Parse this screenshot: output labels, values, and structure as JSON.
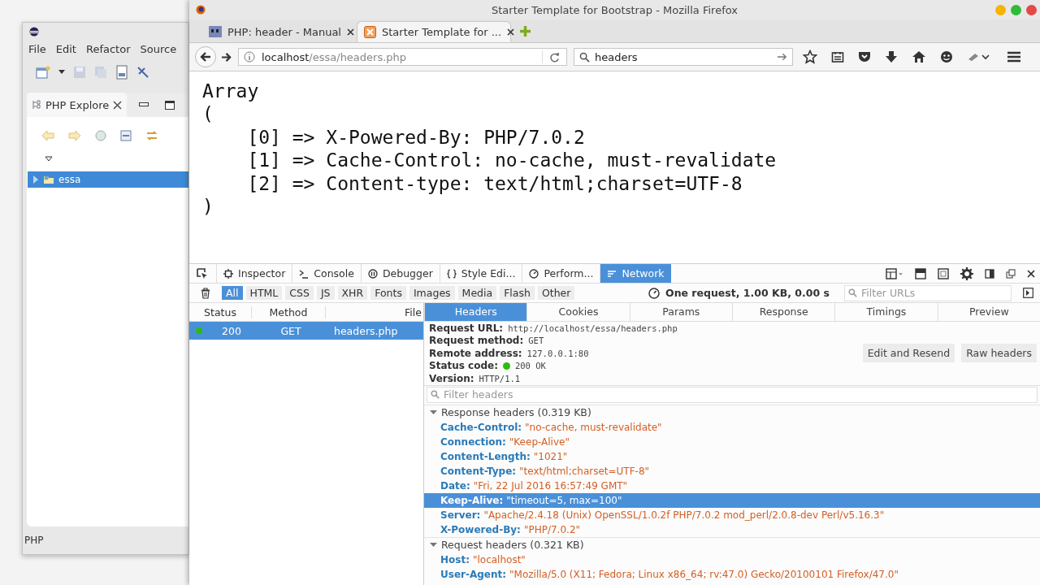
{
  "ide": {
    "menu": [
      "File",
      "Edit",
      "Refactor",
      "Source"
    ],
    "view_tab": "PHP Explore",
    "tree": [
      {
        "label": "essa",
        "expanded": false,
        "selected": true
      }
    ],
    "status": "PHP"
  },
  "browser": {
    "title": "Starter Template for Bootstrap - Mozilla Firefox",
    "tabs": [
      {
        "label": "PHP: header - Manual",
        "kind": "php",
        "selected": false
      },
      {
        "label": "Starter Template for ...",
        "kind": "template",
        "selected": true
      }
    ],
    "url": {
      "host": "localhost",
      "path": "/essa/headers.php"
    },
    "search": "headers"
  },
  "page": {
    "lines": [
      "Array",
      "(",
      "    [0] => X-Powered-By: PHP/7.0.2",
      "    [1] => Cache-Control: no-cache, must-revalidate",
      "    [2] => Content-type: text/html;charset=UTF-8",
      ")"
    ]
  },
  "devtools": {
    "tools": [
      {
        "label": "Inspector",
        "kind": "inspector",
        "selected": false
      },
      {
        "label": "Console",
        "kind": "console",
        "selected": false
      },
      {
        "label": "Debugger",
        "kind": "debugger",
        "selected": false
      },
      {
        "label": "Style Edi...",
        "kind": "style",
        "selected": false
      },
      {
        "label": "Perform...",
        "kind": "performance",
        "selected": false
      },
      {
        "label": "Network",
        "kind": "network",
        "selected": true
      }
    ],
    "filters": [
      {
        "label": "All",
        "selected": true
      },
      {
        "label": "HTML",
        "selected": false
      },
      {
        "label": "CSS",
        "selected": false
      },
      {
        "label": "JS",
        "selected": false
      },
      {
        "label": "XHR",
        "selected": false
      },
      {
        "label": "Fonts",
        "selected": false
      },
      {
        "label": "Images",
        "selected": false
      },
      {
        "label": "Media",
        "selected": false
      },
      {
        "label": "Flash",
        "selected": false
      },
      {
        "label": "Other",
        "selected": false
      }
    ],
    "summary": "One request, 1.00 KB, 0.00 s",
    "filter_placeholder": "Filter URLs",
    "columns": [
      "Status",
      "Method",
      "File"
    ],
    "requests": [
      {
        "status": "200",
        "method": "GET",
        "file": "headers.php",
        "color": "#2cbb0f",
        "selected": true
      }
    ],
    "detail_tabs": [
      {
        "label": "Headers",
        "selected": true
      },
      {
        "label": "Cookies",
        "selected": false
      },
      {
        "label": "Params",
        "selected": false
      },
      {
        "label": "Response",
        "selected": false
      },
      {
        "label": "Timings",
        "selected": false
      },
      {
        "label": "Preview",
        "selected": false
      }
    ],
    "fields": [
      {
        "label": "Request URL:",
        "value": "http://localhost/essa/headers.php",
        "kind": "text"
      },
      {
        "label": "Request method:",
        "value": "GET",
        "kind": "text"
      },
      {
        "label": "Remote address:",
        "value": "127.0.0.1:80",
        "kind": "text"
      },
      {
        "label": "Status code:",
        "value": "200 OK",
        "kind": "status",
        "color": "#2cbb0f"
      },
      {
        "label": "Version:",
        "value": "HTTP/1.1",
        "kind": "text"
      }
    ],
    "buttons": [
      "Edit and Resend",
      "Raw headers"
    ],
    "header_filter_placeholder": "Filter headers",
    "sections": [
      {
        "title": "Response headers (0.319 KB)",
        "expanded": true,
        "headers": [
          {
            "name": "Cache-Control:",
            "value": "\"no-cache, must-revalidate\"",
            "selected": false
          },
          {
            "name": "Connection:",
            "value": "\"Keep-Alive\"",
            "selected": false
          },
          {
            "name": "Content-Length:",
            "value": "\"1021\"",
            "selected": false
          },
          {
            "name": "Content-Type:",
            "value": "\"text/html;charset=UTF-8\"",
            "selected": false
          },
          {
            "name": "Date:",
            "value": "\"Fri, 22 Jul 2016 16:57:49 GMT\"",
            "selected": false
          },
          {
            "name": "Keep-Alive:",
            "value": "\"timeout=5, max=100\"",
            "selected": true
          },
          {
            "name": "Server:",
            "value": "\"Apache/2.4.18 (Unix) OpenSSL/1.0.2f PHP/7.0.2 mod_perl/2.0.8-dev Perl/v5.16.3\"",
            "selected": false
          },
          {
            "name": "X-Powered-By:",
            "value": "\"PHP/7.0.2\"",
            "selected": false
          }
        ]
      },
      {
        "title": "Request headers (0.321 KB)",
        "expanded": true,
        "headers": [
          {
            "name": "Host:",
            "value": "\"localhost\"",
            "selected": false
          },
          {
            "name": "User-Agent:",
            "value": "\"Mozilla/5.0 (X11; Fedora; Linux x86_64; rv:47.0) Gecko/20100101 Firefox/47.0\"",
            "selected": false
          }
        ]
      }
    ]
  }
}
